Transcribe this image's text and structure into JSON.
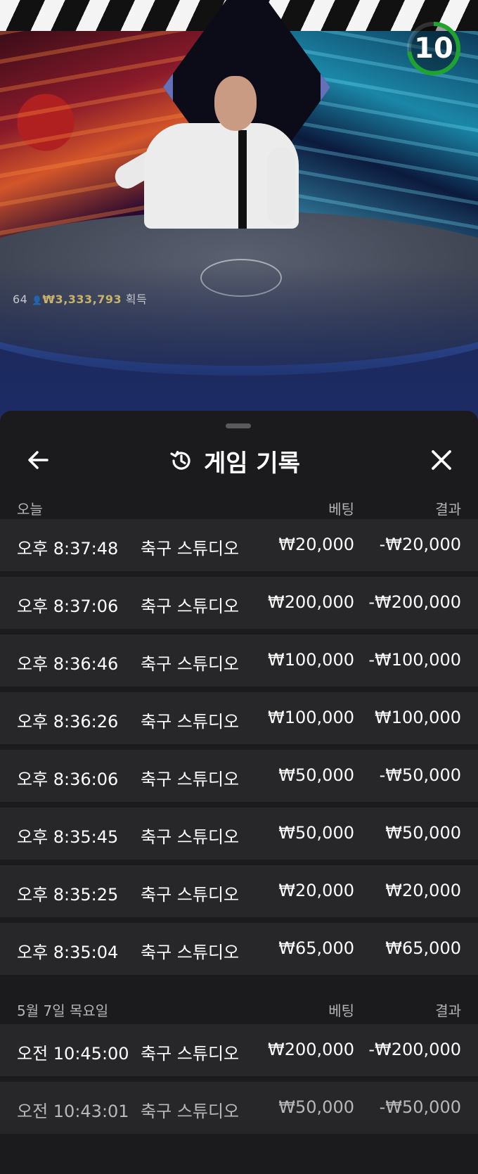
{
  "video": {
    "timer_value": "10",
    "player_count": "64",
    "winnings": "₩3,333,793",
    "winnings_suffix": "획득",
    "timer_color": "#1fa32f"
  },
  "sheet": {
    "title": "게임 기록",
    "icons": {
      "back": "arrow-left-icon",
      "history": "history-icon",
      "close": "close-icon"
    }
  },
  "sections": [
    {
      "date_label": "오늘",
      "bet_header": "베팅",
      "result_header": "결과",
      "rows": [
        {
          "time": "오후 8:37:48",
          "game": "축구 스튜디오",
          "bet": "₩20,000",
          "result": "-₩20,000"
        },
        {
          "time": "오후 8:37:06",
          "game": "축구 스튜디오",
          "bet": "₩200,000",
          "result": "-₩200,000"
        },
        {
          "time": "오후 8:36:46",
          "game": "축구 스튜디오",
          "bet": "₩100,000",
          "result": "-₩100,000"
        },
        {
          "time": "오후 8:36:26",
          "game": "축구 스튜디오",
          "bet": "₩100,000",
          "result": "₩100,000"
        },
        {
          "time": "오후 8:36:06",
          "game": "축구 스튜디오",
          "bet": "₩50,000",
          "result": "-₩50,000"
        },
        {
          "time": "오후 8:35:45",
          "game": "축구 스튜디오",
          "bet": "₩50,000",
          "result": "₩50,000"
        },
        {
          "time": "오후 8:35:25",
          "game": "축구 스튜디오",
          "bet": "₩20,000",
          "result": "₩20,000"
        },
        {
          "time": "오후 8:35:04",
          "game": "축구 스튜디오",
          "bet": "₩65,000",
          "result": "₩65,000"
        }
      ]
    },
    {
      "date_label": "5월 7일 목요일",
      "bet_header": "베팅",
      "result_header": "결과",
      "rows": [
        {
          "time": "오전 10:45:00",
          "game": "축구 스튜디오",
          "bet": "₩200,000",
          "result": "-₩200,000"
        },
        {
          "time": "오전 10:43:01",
          "game": "축구 스튜디오",
          "bet": "₩50,000",
          "result": "-₩50,000"
        }
      ]
    }
  ]
}
